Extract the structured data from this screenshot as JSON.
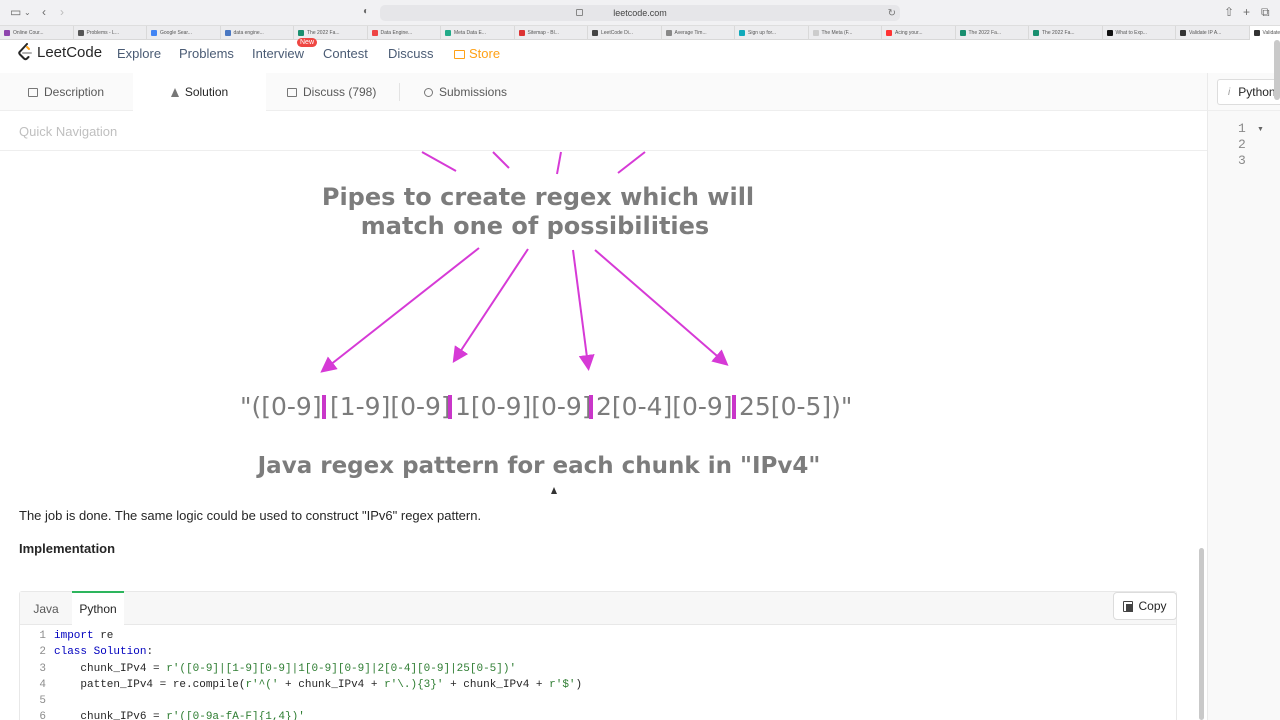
{
  "browser": {
    "url": "leetcode.com",
    "tabs": [
      "Online Cour...",
      "Problems - L...",
      "Google Sear...",
      "data engine...",
      "The 2022 Fa...",
      "Data Engine...",
      "Meta Data E...",
      "Sitemap - Bl...",
      "LeetCode Di...",
      "Average Tim...",
      "Sign up for...",
      "The Meta (F...",
      "Acing your...",
      "The 2022 Fa...",
      "The 2022 Fa...",
      "What to Exp...",
      "Validate IP A...",
      "Validate IP A..."
    ],
    "active_tab_index": 17
  },
  "nav": {
    "logo": "LeetCode",
    "links": [
      "Explore",
      "Problems",
      "Interview",
      "Contest",
      "Discuss"
    ],
    "new_badge": "New",
    "store": "Store"
  },
  "left_tabs": {
    "description": "Description",
    "solution": "Solution",
    "discuss": "Discuss (798)",
    "submissions": "Submissions"
  },
  "quick_nav": "Quick Navigation",
  "diagram": {
    "caption_line1": "Pipes to create regex which will",
    "caption_line2": "match one of possibilities",
    "regex_parts": [
      "\"([0-9]",
      "[1-9][0-9]",
      "1[0-9][0-9]",
      "2[0-4][0-9]",
      "25[0-5])\""
    ],
    "subtitle": "Java regex pattern for each chunk in \"IPv4\""
  },
  "paragraph": "The job is done. The same logic could be used to construct \"IPv6\" regex pattern.",
  "implementation_heading": "Implementation",
  "code_tabs": {
    "java": "Java",
    "python": "Python",
    "copy": "Copy"
  },
  "code_lines": [
    {
      "n": "1",
      "text": "import re"
    },
    {
      "n": "2",
      "text": "class Solution:"
    },
    {
      "n": "3",
      "text": "    chunk_IPv4 = r'([0-9]|[1-9][0-9]|1[0-9][0-9]|2[0-4][0-9]|25[0-5])'"
    },
    {
      "n": "4",
      "text": "    patten_IPv4 = re.compile(r'^(' + chunk_IPv4 + r'\\.){3}' + chunk_IPv4 + r'$')"
    },
    {
      "n": "5",
      "text": ""
    },
    {
      "n": "6",
      "text": "    chunk_IPv6 = r'([0-9a-fA-F]{1,4})'"
    }
  ],
  "editor": {
    "language": "Python",
    "line_numbers": [
      "1",
      "2",
      "3"
    ]
  },
  "colors": {
    "pipe": "#c936c9",
    "arrow": "#d63ad6",
    "store": "#ffa116",
    "active_tab_accent": "#2db55d"
  }
}
